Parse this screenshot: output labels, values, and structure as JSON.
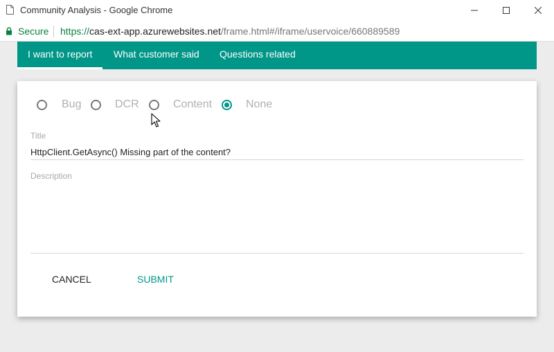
{
  "window": {
    "title": "Community Analysis - Google Chrome"
  },
  "address_bar": {
    "secure_label": "Secure",
    "url_scheme": "https://",
    "url_host": "cas-ext-app.azurewebsites.net",
    "url_path": "/frame.html#/iframe/uservoice/660889589"
  },
  "tabs": [
    {
      "label": "I want to report",
      "active": true
    },
    {
      "label": "What customer said",
      "active": false
    },
    {
      "label": "Questions related",
      "active": false
    }
  ],
  "report_type": {
    "options": [
      {
        "label": "Bug",
        "checked": false
      },
      {
        "label": "DCR",
        "checked": false
      },
      {
        "label": "Content",
        "checked": false
      },
      {
        "label": "None",
        "checked": true
      }
    ]
  },
  "form": {
    "title_label": "Title",
    "title_value": "HttpClient.GetAsync() Missing part of the content?",
    "description_label": "Description",
    "description_value": ""
  },
  "actions": {
    "cancel_label": "CANCEL",
    "submit_label": "SUBMIT"
  },
  "colors": {
    "accent": "#009688",
    "secure_green": "#0b8043"
  }
}
